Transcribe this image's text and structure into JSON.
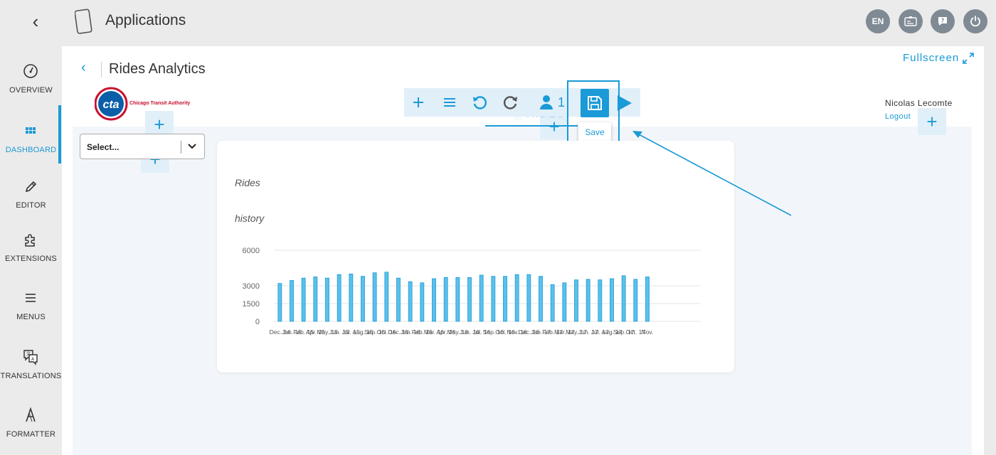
{
  "topbar": {
    "title": "Applications",
    "language": "EN",
    "icons": [
      "back-chevron-icon",
      "tablet-icon",
      "id-card-icon",
      "help-chat-icon",
      "power-icon"
    ]
  },
  "nav": {
    "items": [
      {
        "label": "OVERVIEW",
        "icon": "gauge-icon"
      },
      {
        "label": "DASHBOARD",
        "icon": "grid-icon"
      },
      {
        "label": "EDITOR",
        "icon": "pencil-icon"
      },
      {
        "label": "EXTENSIONS",
        "icon": "puzzle-icon"
      },
      {
        "label": "MENUS",
        "icon": "hamburger-icon"
      },
      {
        "label": "TRANSLATIONS",
        "icon": "translate-icon"
      },
      {
        "label": "FORMATTER",
        "icon": "formatter-icon"
      }
    ],
    "active": "DASHBOARD"
  },
  "page": {
    "title": "Rides Analytics",
    "fullscreen": "Fullscreen",
    "logo_text": "cta",
    "logo_caption": "Chicago Transit Authority",
    "user": "Nicolas Lecomte",
    "logout": "Logout",
    "select_value": "Select...",
    "tab_label": "RIDES"
  },
  "toolbar": {
    "count": "1",
    "save_tooltip": "Save",
    "accent": "#1a9ad6"
  },
  "card": {
    "title_line1": "Rides",
    "title_line2": "history"
  },
  "chart_data": {
    "type": "bar",
    "yticks": [
      0,
      1500,
      3000,
      6000
    ],
    "ylim": [
      0,
      6000
    ],
    "categories": [
      "Dec. 14",
      "Jan. 15",
      "Feb. 15",
      "Apr. 15",
      "May. 15",
      "Jun. 15",
      "Jul. 15",
      "Aug. 15",
      "Sep. 15",
      "Oct. 15",
      "Dec. 15",
      "Jan. 16",
      "Feb. 16",
      "Mar. 16",
      "Apr. 16",
      "May. 16",
      "Jun. 16",
      "Jul. 16",
      "Sep. 16",
      "Oct. 16",
      "Nov. 16",
      "Dec. 16",
      "Jan. 17",
      "Feb. 17",
      "Mar. 17",
      "May. 17",
      "Jun. 17",
      "Jul. 17",
      "Aug. 17",
      "Sep. 17",
      "Oct. 17",
      "Nov."
    ],
    "values": [
      3200,
      3450,
      3650,
      3750,
      3650,
      3950,
      4000,
      3800,
      4100,
      4150,
      3650,
      3350,
      3250,
      3600,
      3700,
      3700,
      3700,
      3900,
      3800,
      3800,
      3950,
      3950,
      3800,
      3100,
      3250,
      3500,
      3550,
      3500,
      3600,
      3850,
      3550,
      3750,
      null,
      null,
      null,
      null
    ],
    "bar_color": "#5bc0eb",
    "bar_stroke": "#1a9ad6"
  }
}
